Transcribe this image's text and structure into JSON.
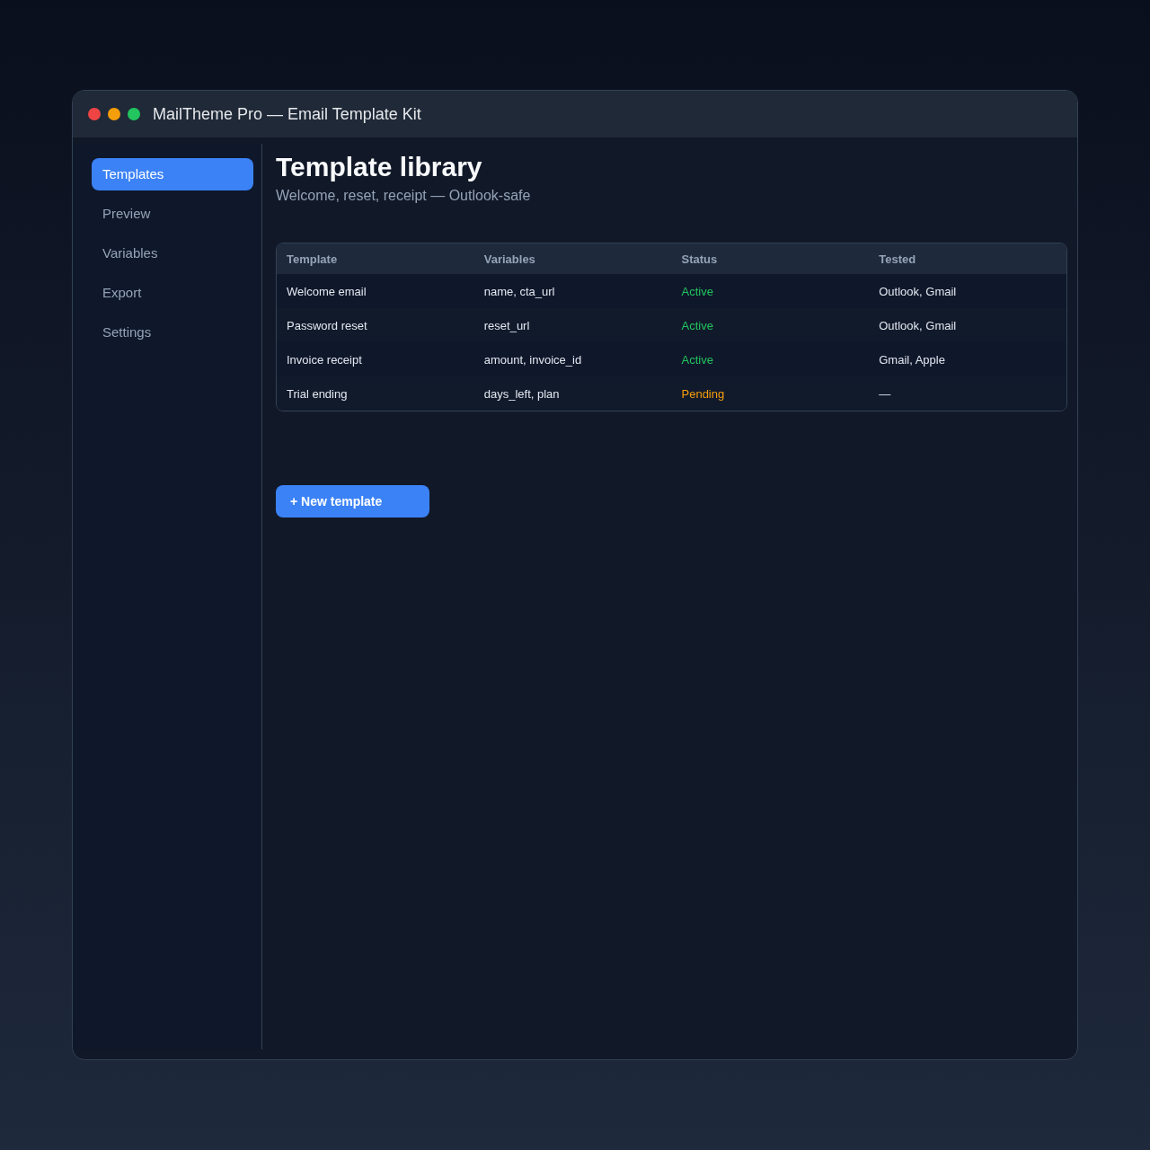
{
  "window": {
    "title": "MailTheme Pro — Email Template Kit"
  },
  "sidebar": {
    "items": [
      {
        "label": "Templates",
        "selected": true
      },
      {
        "label": "Preview",
        "selected": false
      },
      {
        "label": "Variables",
        "selected": false
      },
      {
        "label": "Export",
        "selected": false
      },
      {
        "label": "Settings",
        "selected": false
      }
    ]
  },
  "header": {
    "title": "Template library",
    "subtitle": "Welcome, reset, receipt — Outlook-safe"
  },
  "table": {
    "columns": [
      "Template",
      "Variables",
      "Status",
      "Tested"
    ],
    "rows": [
      {
        "template": "Welcome email",
        "variables": "name, cta_url",
        "status": {
          "text": "Active",
          "color": "#22c55e"
        },
        "tested": "Outlook, Gmail"
      },
      {
        "template": "Password reset",
        "variables": "reset_url",
        "status": {
          "text": "Active",
          "color": "#22c55e"
        },
        "tested": "Outlook, Gmail"
      },
      {
        "template": "Invoice receipt",
        "variables": "amount, invoice_id",
        "status": {
          "text": "Active",
          "color": "#22c55e"
        },
        "tested": "Gmail, Apple"
      },
      {
        "template": "Trial ending",
        "variables": "days_left, plan",
        "status": {
          "text": "Pending",
          "color": "#f59e0b"
        },
        "tested": "—"
      }
    ]
  },
  "actions": {
    "new_template_button": "+ New template"
  }
}
